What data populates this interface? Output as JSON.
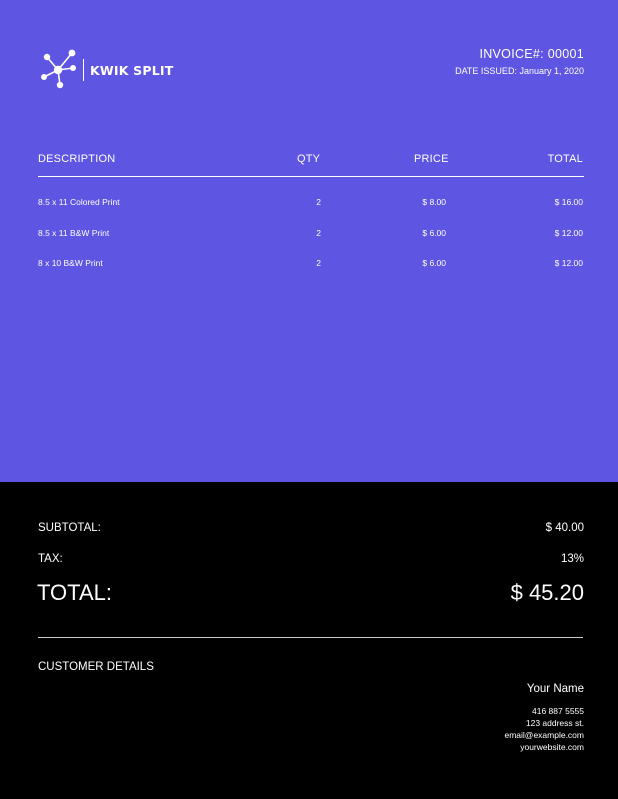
{
  "brand": {
    "name": "KWIK SPLIT",
    "logo_icon": "molecule-network-icon"
  },
  "invoice": {
    "number": "INVOICE#: 00001",
    "date_issued": "DATE ISSUED: January 1, 2020"
  },
  "table": {
    "headers": {
      "description": "DESCRIPTION",
      "qty": "QTY",
      "price": "PRICE",
      "total": "TOTAL"
    },
    "rows": [
      {
        "description": "8.5 x 11 Colored Print",
        "qty": "2",
        "price": "$ 8.00",
        "total": "$ 16.00"
      },
      {
        "description": "8.5 x 11 B&W  Print",
        "qty": "2",
        "price": "$ 6.00",
        "total": "$ 12.00"
      },
      {
        "description": "8 x 10 B&W  Print",
        "qty": "2",
        "price": "$ 6.00",
        "total": "$ 12.00"
      }
    ]
  },
  "summary": {
    "subtotal_label": "SUBTOTAL:",
    "subtotal_value": "$ 40.00",
    "tax_label": "TAX:",
    "tax_value": "13%",
    "total_label": "TOTAL:",
    "total_value": "$ 45.20"
  },
  "customer": {
    "section_title": "CUSTOMER DETAILS",
    "name": "Your Name",
    "phone": "416 887 5555",
    "address": "123 address st.",
    "email": "email@example.com",
    "website": "yourwebsite.com"
  },
  "colors": {
    "top_background": "#5f55e3",
    "bottom_background": "#000000",
    "text": "#ffffff"
  }
}
